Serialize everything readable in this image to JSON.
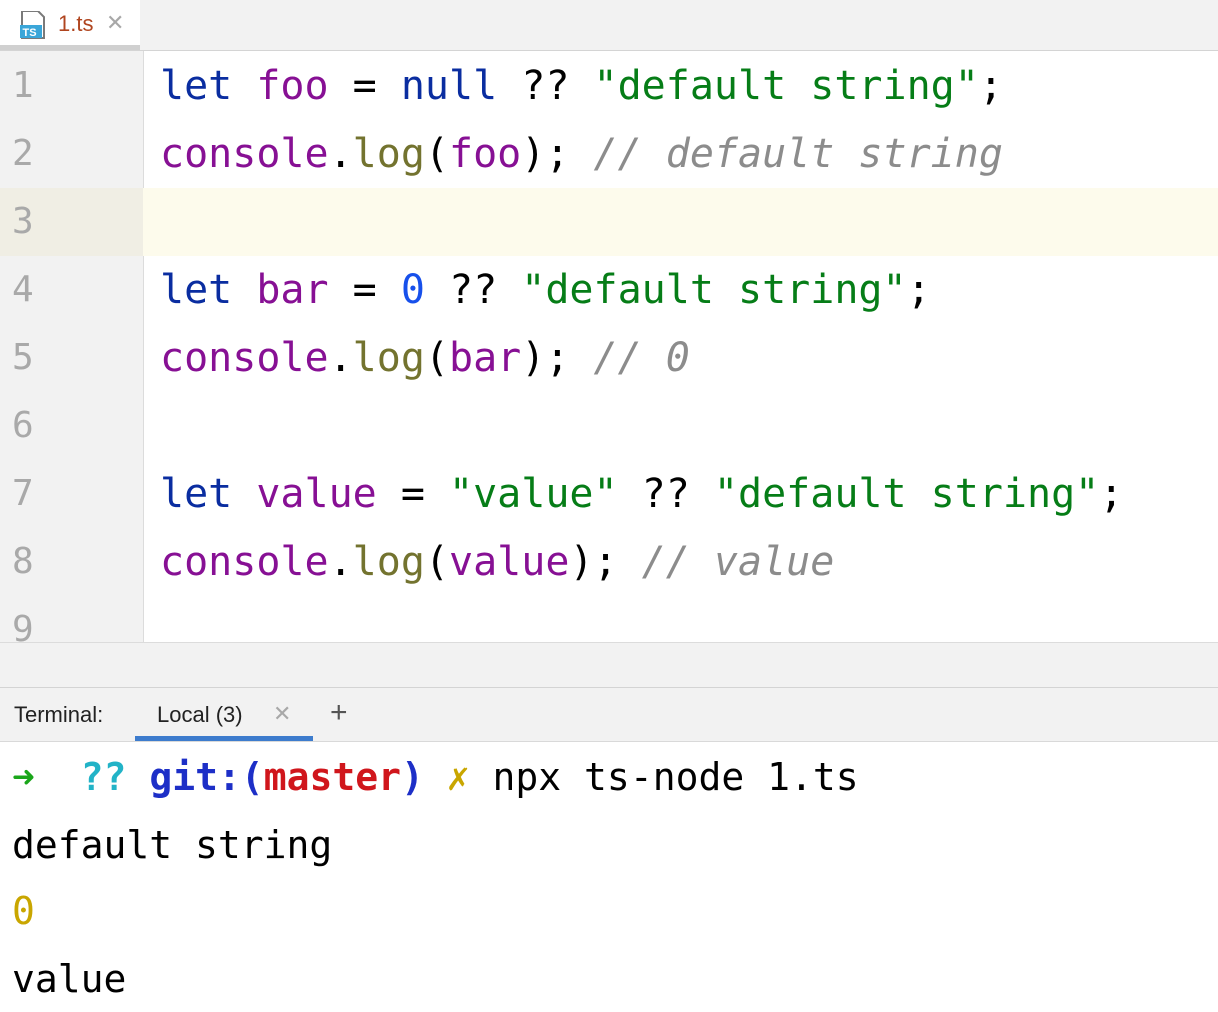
{
  "editor_tab": {
    "icon_text": "TS",
    "filename": "1.ts",
    "close_glyph": "✕"
  },
  "editor": {
    "lines": [
      {
        "number": "1",
        "tokens": [
          {
            "t": "let",
            "c": "kw"
          },
          {
            "t": " "
          },
          {
            "t": "foo",
            "c": "var"
          },
          {
            "t": " = "
          },
          {
            "t": "null",
            "c": "kw"
          },
          {
            "t": " ?? "
          },
          {
            "t": "\"default string\"",
            "c": "str"
          },
          {
            "t": ";"
          }
        ]
      },
      {
        "number": "2",
        "tokens": [
          {
            "t": "console",
            "c": "var"
          },
          {
            "t": "."
          },
          {
            "t": "log",
            "c": "fn"
          },
          {
            "t": "("
          },
          {
            "t": "foo",
            "c": "var"
          },
          {
            "t": "); "
          },
          {
            "t": "// default string",
            "c": "cmt"
          }
        ]
      },
      {
        "number": "3",
        "tokens": []
      },
      {
        "number": "4",
        "tokens": [
          {
            "t": "let",
            "c": "kw"
          },
          {
            "t": " "
          },
          {
            "t": "bar",
            "c": "var"
          },
          {
            "t": " = "
          },
          {
            "t": "0",
            "c": "num"
          },
          {
            "t": " ?? "
          },
          {
            "t": "\"default string\"",
            "c": "str"
          },
          {
            "t": ";"
          }
        ]
      },
      {
        "number": "5",
        "tokens": [
          {
            "t": "console",
            "c": "var"
          },
          {
            "t": "."
          },
          {
            "t": "log",
            "c": "fn"
          },
          {
            "t": "("
          },
          {
            "t": "bar",
            "c": "var"
          },
          {
            "t": "); "
          },
          {
            "t": "// 0",
            "c": "cmt"
          }
        ]
      },
      {
        "number": "6",
        "tokens": []
      },
      {
        "number": "7",
        "tokens": [
          {
            "t": "let",
            "c": "kw"
          },
          {
            "t": " "
          },
          {
            "t": "value",
            "c": "var"
          },
          {
            "t": " = "
          },
          {
            "t": "\"value\"",
            "c": "str"
          },
          {
            "t": " ?? "
          },
          {
            "t": "\"default string\"",
            "c": "str"
          },
          {
            "t": ";"
          }
        ]
      },
      {
        "number": "8",
        "tokens": [
          {
            "t": "console",
            "c": "var"
          },
          {
            "t": "."
          },
          {
            "t": "log",
            "c": "fn"
          },
          {
            "t": "("
          },
          {
            "t": "value",
            "c": "var"
          },
          {
            "t": "); "
          },
          {
            "t": "// value",
            "c": "cmt"
          }
        ]
      },
      {
        "number": "9",
        "tokens": []
      }
    ]
  },
  "terminal_bar": {
    "title": "Terminal:",
    "tab_label": "Local (3)",
    "tab_close": "✕",
    "add_glyph": "+"
  },
  "terminal": {
    "prompt_arrow": "➜",
    "prompt_dir": "??",
    "git_prefix": "git:(",
    "git_branch": "master",
    "git_suffix": ")",
    "dirty_mark": "✗",
    "command": "npx ts-node 1.ts",
    "output": [
      "default string",
      "0",
      "value"
    ]
  },
  "colors": {
    "keyword": "#0a2da0",
    "variable": "#871094",
    "string": "#067d17",
    "function": "#73732f",
    "number": "#1750eb",
    "comment": "#8c8c8c",
    "terminal_tab_accent": "#3d7ccd"
  }
}
